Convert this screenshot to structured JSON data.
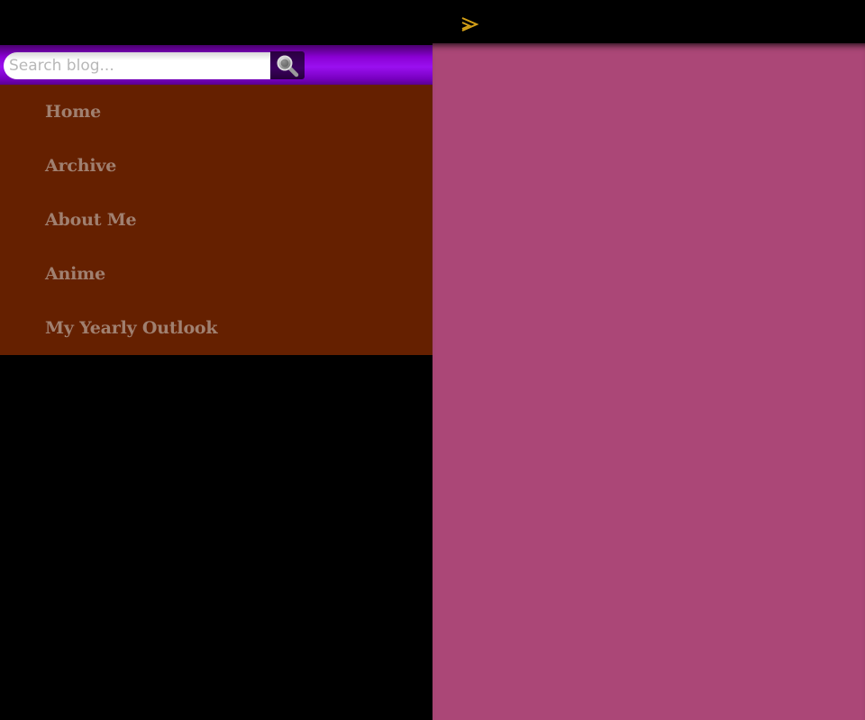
{
  "topbar": {
    "toggle_icon": "double-chevron-right-icon",
    "toggle_color": "#d4a017"
  },
  "search": {
    "placeholder": "Search blog...",
    "value": "",
    "button_icon": "magnifier-icon"
  },
  "nav": {
    "items": [
      {
        "label": "Home"
      },
      {
        "label": "Archive"
      },
      {
        "label": "About Me"
      },
      {
        "label": "Anime"
      },
      {
        "label": "My Yearly Outlook"
      }
    ]
  },
  "colors": {
    "topbar_bg": "#000000",
    "search_bar_accent": "#9a10f0",
    "nav_bg": "#652000",
    "nav_text": "#a08070",
    "content_bg": "#ab4777"
  }
}
